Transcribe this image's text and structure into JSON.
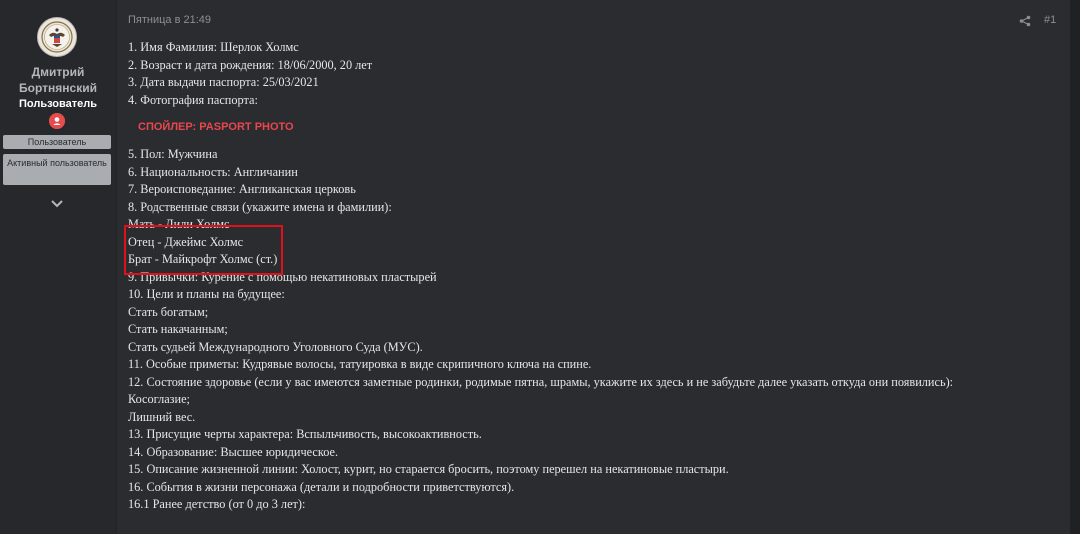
{
  "user": {
    "name_line1": "Дмитрий",
    "name_line2": "Бортнянский",
    "role": "Пользователь",
    "banners": [
      "Пользователь",
      "Активный пользователь"
    ],
    "avatar_icon": "seal-emblem-icon",
    "role_icon": "user-role-icon"
  },
  "post": {
    "date": "Пятница в 21:49",
    "number": "#1",
    "spoiler_label": "СПОЙЛЕР: PASPORT PHOTO",
    "lines_before_spoiler": [
      "1. Имя Фамилия: Шерлок Холмс",
      "2. Возраст и дата рождения: 18/06/2000, 20 лет",
      "3. Дата выдачи паспорта: 25/03/2021",
      "4. Фотография паспорта:"
    ],
    "lines_after_spoiler": [
      "5. Пол: Мужчина",
      "6. Национальность: Англичанин",
      "7. Вероисповедание: Англиканская церковь",
      "8. Родственные связи (укажите имена и фамилии):",
      "Мать - Лили Холмс",
      "Отец - Джеймс Холмс",
      "Брат - Майкрофт Холмс (ст.)",
      "9. Привычки: Курение с помощью некатиновых пластырей",
      "10. Цели и планы на будущее:",
      "Стать богатым;",
      "Стать накачанным;",
      "Стать судьей Международного Уголовного Суда (МУС).",
      "11. Особые приметы: Кудрявые волосы, татуировка в виде скрипичного ключа на спине.",
      "12. Состояние здоровье (если у вас имеются заметные родинки, родимые пятна, шрамы, укажите их здесь и не забудьте далее указать откуда они появились):",
      "Косоглазие;",
      "Лишний вес.",
      "13. Присущие черты характера: Вспыльчивость, высокоактивность.",
      "14. Образование: Высшее юридическое.",
      "15. Описание жизненной линии: Холост, курит, но старается бросить, поэтому перешел на некатиновые пластыри.",
      "16. События в жизни персонажа (детали и подробности приветствуются).",
      "16.1 Ранее детство (от 0 до 3 лет):"
    ]
  },
  "colors": {
    "background": "#2a2c30",
    "sidebar": "#26282b",
    "text": "#e6e6e6",
    "muted": "#8c8f94",
    "spoiler": "#e9474d",
    "highlight_box": "#e0111b",
    "banner": "#a9acb1"
  }
}
